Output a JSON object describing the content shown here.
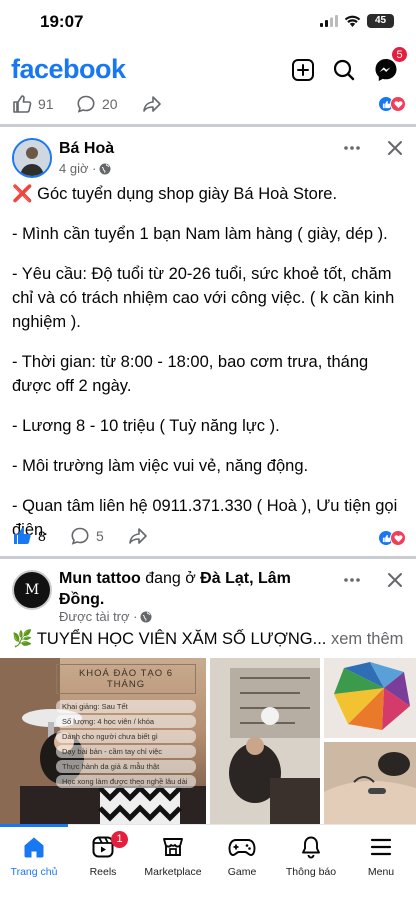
{
  "status_bar": {
    "time": "19:07",
    "battery": "45"
  },
  "header": {
    "brand": "facebook",
    "messenger_badge": "5"
  },
  "previous_post": {
    "like_count": "91",
    "comment_count": "20"
  },
  "post": {
    "author": "Bá Hoà",
    "time": "4 giờ ·",
    "paragraphs": [
      "❌ Góc tuyển dụng shop giày Bá Hoà Store.",
      "- Mình cần tuyển 1 bạn Nam làm hàng ( giày, dép ).",
      "- Yêu cầu: Độ tuổi từ 20-26 tuổi, sức khoẻ tốt, chăm chỉ và có trách nhiệm cao với công việc. ( k cần kinh nghiệm ).",
      "- Thời gian: từ 8:00 - 18:00, bao cơm trưa, tháng được off 2 ngày.",
      "- Lương 8 - 10 triệu ( Tuỳ năng lực ).",
      "- Môi trường làm việc vui vẻ, năng động.",
      "- Quan tâm liên hệ 0911.371.330 ( Hoà ), Ưu tiện gọi điện."
    ],
    "like_count": "8",
    "comment_count": "5"
  },
  "sponsored": {
    "page_name": "Mun tattoo",
    "connector": " đang ở ",
    "location": "Đà Lạt, Lâm Đồng.",
    "label": "Được tài trợ ·",
    "caption": "🌿 TUYỂN HỌC VIÊN XĂM  SỐ LƯỢNG...",
    "see_more": " xem thêm",
    "avatar_text": "M",
    "poster": {
      "title": "KHOÁ ĐÀO TẠO 6 THÁNG",
      "lines": [
        "Khai giảng: Sau Tết",
        "Số lượng: 4 học viên / khóa",
        "Dành cho người chưa biết gì",
        "Dạy bài bản - cầm tay chỉ việc",
        "Thực hành da giả & mẫu thật",
        "Học xong làm được theo nghề lâu dài"
      ]
    }
  },
  "bottom_nav": {
    "items": [
      {
        "label": "Trang chủ",
        "icon": "home-icon",
        "active": true
      },
      {
        "label": "Reels",
        "icon": "reels-icon",
        "badge": "1"
      },
      {
        "label": "Marketplace",
        "icon": "marketplace-icon"
      },
      {
        "label": "Game",
        "icon": "game-controller-icon"
      },
      {
        "label": "Thông báo",
        "icon": "bell-icon"
      },
      {
        "label": "Menu",
        "icon": "hamburger-menu-icon"
      }
    ]
  },
  "colors": {
    "brand": "#1877f2",
    "like": "#1877f2",
    "love": "#f33e58",
    "badge": "#e41e3f",
    "muted": "#65676b"
  }
}
